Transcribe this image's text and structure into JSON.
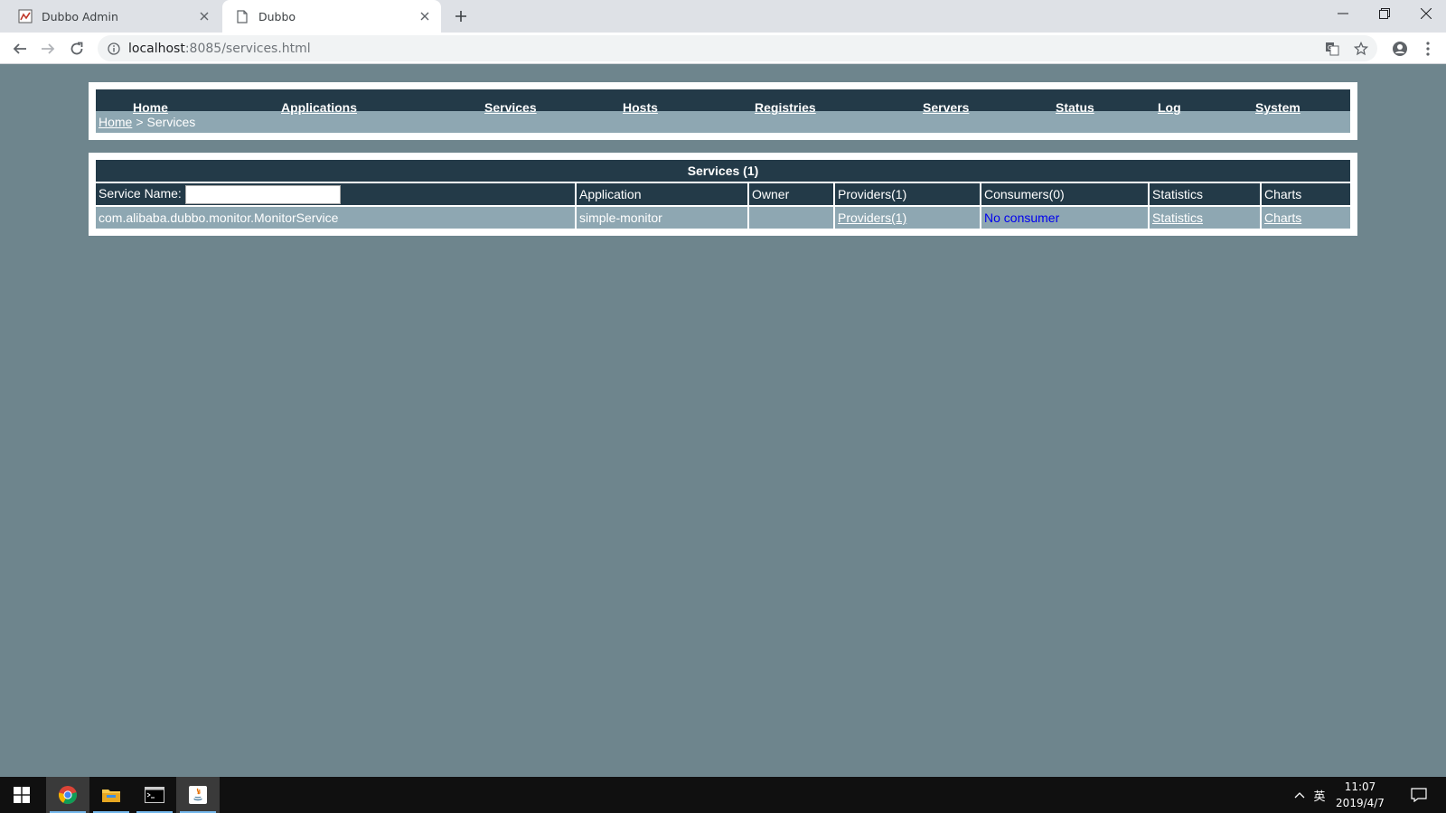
{
  "browser": {
    "tabs": [
      {
        "title": "Dubbo Admin",
        "active": false,
        "icon": "dubbo-favicon-icon"
      },
      {
        "title": "Dubbo",
        "active": true,
        "icon": "page-icon"
      }
    ],
    "url_host": "localhost",
    "url_rest": ":8085/services.html"
  },
  "menu": {
    "items": [
      "Home",
      "Applications",
      "Services",
      "Hosts",
      "Registries",
      "Servers",
      "Status",
      "Log",
      "System"
    ]
  },
  "breadcrumb": {
    "home": "Home",
    "separator": ">",
    "current": "Services"
  },
  "services": {
    "title": "Services (1)",
    "search_label": "Service Name:",
    "search_value": "",
    "headers": {
      "application": "Application",
      "owner": "Owner",
      "providers": "Providers(1)",
      "consumers": "Consumers(0)",
      "statistics": "Statistics",
      "charts": "Charts"
    },
    "rows": [
      {
        "service": "com.alibaba.dubbo.monitor.MonitorService",
        "application": "simple-monitor",
        "owner": "",
        "providers": "Providers(1)",
        "consumers": "No consumer",
        "statistics": "Statistics",
        "charts": "Charts"
      }
    ]
  },
  "taskbar": {
    "input_method": "英",
    "time": "11:07",
    "date": "2019/4/7"
  },
  "colors": {
    "page_bg": "#6e858d",
    "header_dark": "#233a48",
    "row_light": "#8ea7b2",
    "link_blue": "#0000ee"
  }
}
